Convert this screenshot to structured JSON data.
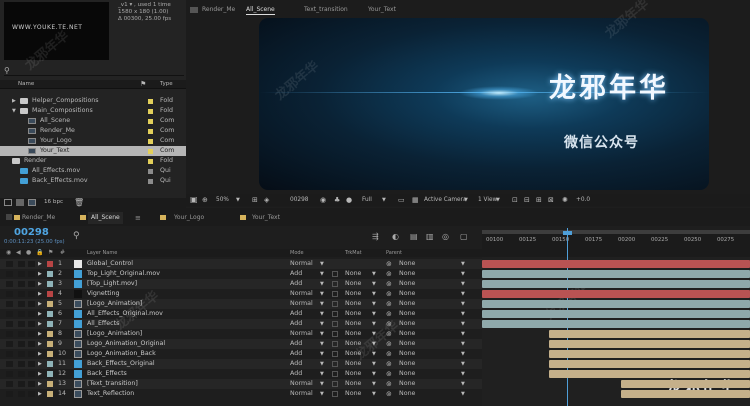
{
  "project": {
    "thumb_text": "WWW.YOUKE.TE.NET",
    "info_lines": [
      "_v1 ▾ , used 1 time",
      "1580 x 180 (1.00)",
      "Δ 00300, 25.00 fps"
    ],
    "search_placeholder": "",
    "col_name": "Name",
    "col_type": "Type",
    "items": [
      {
        "name": "Helper_Compositions",
        "type": "Fold",
        "icon": "folder-icon",
        "indent": 1,
        "label_color": "#e2cf5a",
        "selected": false,
        "arrow": "▶"
      },
      {
        "name": "Main_Compositions",
        "type": "Fold",
        "icon": "folder-icon",
        "indent": 1,
        "label_color": "#e2cf5a",
        "selected": false,
        "arrow": "▼"
      },
      {
        "name": "All_Scene",
        "type": "Com",
        "icon": "composition-icon",
        "indent": 2,
        "label_color": "#e2cf5a",
        "selected": false,
        "arrow": ""
      },
      {
        "name": "Render_Me",
        "type": "Com",
        "icon": "composition-icon",
        "indent": 2,
        "label_color": "#e2cf5a",
        "selected": false,
        "arrow": ""
      },
      {
        "name": "Your_Logo",
        "type": "Com",
        "icon": "composition-icon",
        "indent": 2,
        "label_color": "#e2cf5a",
        "selected": false,
        "arrow": ""
      },
      {
        "name": "Your_Text",
        "type": "Com",
        "icon": "composition-icon",
        "indent": 2,
        "label_color": "#e2cf5a",
        "selected": true,
        "arrow": ""
      },
      {
        "name": "Render",
        "type": "Fold",
        "icon": "folder-icon",
        "indent": 0,
        "label_color": "#e2cf5a",
        "selected": false,
        "arrow": ""
      },
      {
        "name": "All_Effects.mov",
        "type": "Qui",
        "icon": "footage-icon",
        "indent": 1,
        "label_color": "#8c8c8c",
        "selected": false,
        "arrow": ""
      },
      {
        "name": "Back_Effects.mov",
        "type": "Qui",
        "icon": "footage-icon",
        "indent": 1,
        "label_color": "#8c8c8c",
        "selected": false,
        "arrow": ""
      }
    ],
    "bpc": "16 bpc"
  },
  "viewer": {
    "tabs": [
      "Render_Me",
      "All_Scene",
      "Text_transition",
      "Your_Text"
    ],
    "active_tab": 1,
    "title_text": "龙邪年华",
    "subtitle_text": "微信公众号",
    "toolbar": {
      "zoom": "50%",
      "timecode": "00298",
      "resolution": "Full",
      "camera": "Active Camera",
      "view": "1 View",
      "exposure": "+0.0"
    }
  },
  "timeline": {
    "tabs": [
      {
        "label": "Render_Me",
        "color": "#d6b35c"
      },
      {
        "label": "All_Scene",
        "color": "#d6b35c",
        "active": true
      },
      {
        "label": "Your_Logo",
        "color": "#d6b35c"
      },
      {
        "label": "Your_Text",
        "color": "#d6b35c"
      }
    ],
    "timecode": "00298",
    "timecode_sub": "0:00:11:23 (25.00 fps)",
    "columns": {
      "layer_name": "Layer Name",
      "mode": "Mode",
      "trkmat": "TrkMat",
      "parent": "Parent"
    },
    "ruler_labels": [
      "00100",
      "00125",
      "00150",
      "00175",
      "00200",
      "00225",
      "00250",
      "00275"
    ],
    "layers": [
      {
        "num": "1",
        "name": "Global_Control",
        "src": "solid",
        "label": "#b84545",
        "mode": "Normal",
        "trk": "",
        "parent": "None",
        "bar_color": "#b95353",
        "bar_start": 0.0
      },
      {
        "num": "2",
        "name": "Top_Light_Original.mov",
        "src": "footage",
        "label": "#8fb3b8",
        "mode": "Add",
        "trk": "None",
        "parent": "None",
        "bar_color": "#8fa9ab",
        "bar_start": 0.0
      },
      {
        "num": "3",
        "name": "[Top_Light.mov]",
        "src": "footage",
        "label": "#8fb3b8",
        "mode": "Add",
        "trk": "None",
        "parent": "None",
        "bar_color": "#8fa9ab",
        "bar_start": 0.0
      },
      {
        "num": "4",
        "name": "Vignetting",
        "src": "solid-black",
        "label": "#b84545",
        "mode": "Normal",
        "trk": "None",
        "parent": "None",
        "bar_color": "#b95353",
        "bar_start": 0.0
      },
      {
        "num": "5",
        "name": "[Logo_Animation]",
        "src": "comp",
        "label": "#c8b078",
        "mode": "Normal",
        "trk": "None",
        "parent": "None",
        "bar_color": "#8fa9ab",
        "bar_start": 0.0
      },
      {
        "num": "6",
        "name": "All_Effects_Original.mov",
        "src": "footage",
        "label": "#8fb3b8",
        "mode": "Add",
        "trk": "None",
        "parent": "None",
        "bar_color": "#8fa9ab",
        "bar_start": 0.0
      },
      {
        "num": "7",
        "name": "All_Effects",
        "src": "footage",
        "label": "#8fb3b8",
        "mode": "Add",
        "trk": "None",
        "parent": "None",
        "bar_color": "#8fa9ab",
        "bar_start": 0.0
      },
      {
        "num": "8",
        "name": "[Logo_Animation]",
        "src": "comp",
        "label": "#c8b078",
        "mode": "Normal",
        "trk": "None",
        "parent": "None",
        "bar_color": "#c5b08a",
        "bar_start": 0.25
      },
      {
        "num": "9",
        "name": "Logo_Animation_Original",
        "src": "comp",
        "label": "#c8b078",
        "mode": "Add",
        "trk": "None",
        "parent": "None",
        "bar_color": "#c5b08a",
        "bar_start": 0.25
      },
      {
        "num": "10",
        "name": "Logo_Animation_Back",
        "src": "comp",
        "label": "#c8b078",
        "mode": "Add",
        "trk": "None",
        "parent": "None",
        "bar_color": "#c5b08a",
        "bar_start": 0.25
      },
      {
        "num": "11",
        "name": "Back_Effects_Original",
        "src": "footage",
        "label": "#8fb3b8",
        "mode": "Add",
        "trk": "None",
        "parent": "None",
        "bar_color": "#c5b08a",
        "bar_start": 0.25
      },
      {
        "num": "12",
        "name": "Back_Effects",
        "src": "footage",
        "label": "#8fb3b8",
        "mode": "Add",
        "trk": "None",
        "parent": "None",
        "bar_color": "#c5b08a",
        "bar_start": 0.25
      },
      {
        "num": "13",
        "name": "[Text_transition]",
        "src": "comp",
        "label": "#c8b078",
        "mode": "Normal",
        "trk": "None",
        "parent": "None",
        "bar_color": "#c5b08a",
        "bar_start": 0.52
      },
      {
        "num": "14",
        "name": "Text_Reflection",
        "src": "comp",
        "label": "#c8b078",
        "mode": "Normal",
        "trk": "None",
        "parent": "None",
        "bar_color": "#c5b08a",
        "bar_start": 0.52
      }
    ]
  },
  "watermark": "龙邪年华",
  "colors": {
    "accent": "#4fa5e2",
    "panel": "#232323"
  }
}
